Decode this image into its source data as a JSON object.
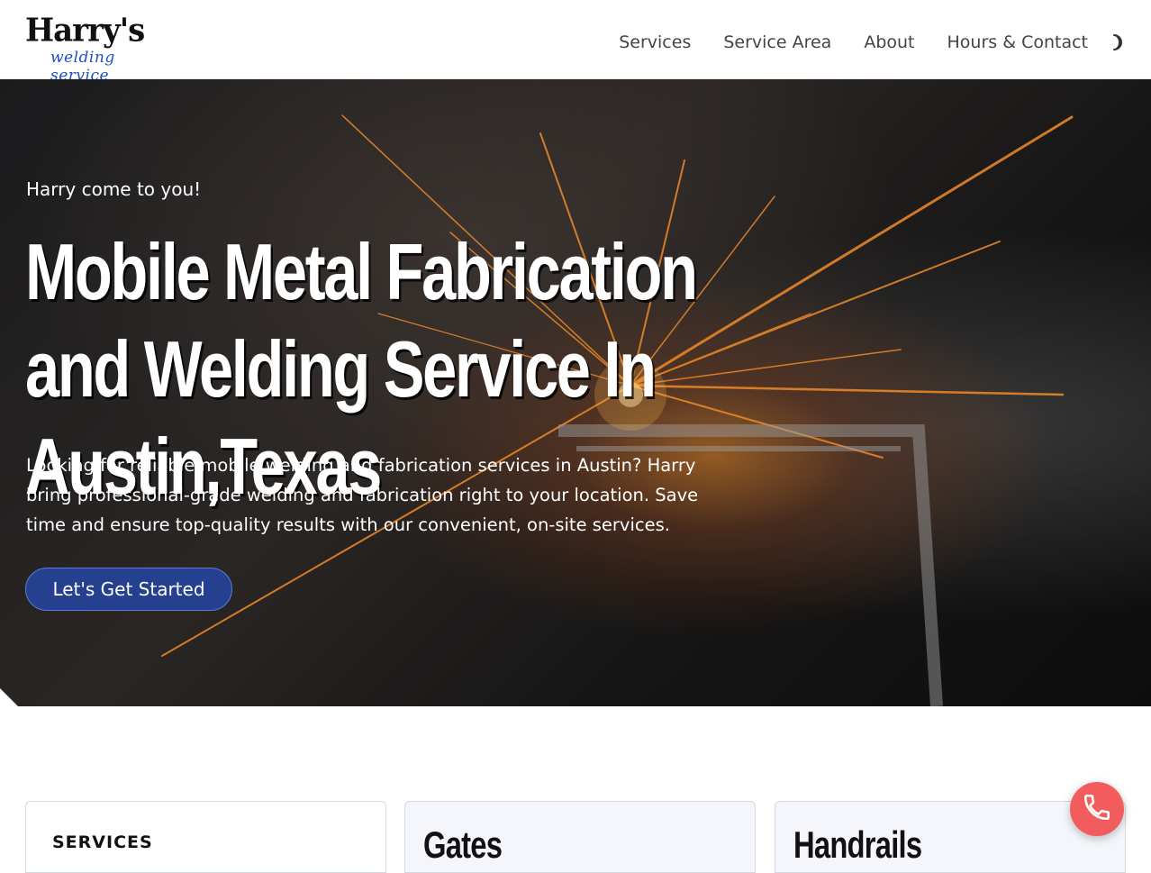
{
  "header": {
    "logo_main": "Harry's",
    "logo_sub": "welding service",
    "nav": [
      {
        "label": "Services"
      },
      {
        "label": "Service Area"
      },
      {
        "label": "About"
      },
      {
        "label": "Hours & Contact"
      }
    ],
    "theme_toggle_icon": "moon-icon"
  },
  "hero": {
    "eyebrow": "Harry come to you!",
    "title": "Mobile Metal Fabrication and Welding Service In Austin,Texas",
    "description": "Looking for reliable mobile welding and fabrication services in Austin? Harry bring professional-grade welding and fabrication right to your location. Save time and ensure top-quality results with our convenient, on-site services.",
    "cta_label": "Let's Get Started"
  },
  "cards": {
    "services_label": "SERVICES",
    "gates_title": "Gates",
    "handrails_title": "Handrails"
  },
  "fab": {
    "icon": "phone-icon",
    "color": "#f25c5c"
  },
  "colors": {
    "accent": "#24408e",
    "logo_sub": "#1f4fbf"
  }
}
